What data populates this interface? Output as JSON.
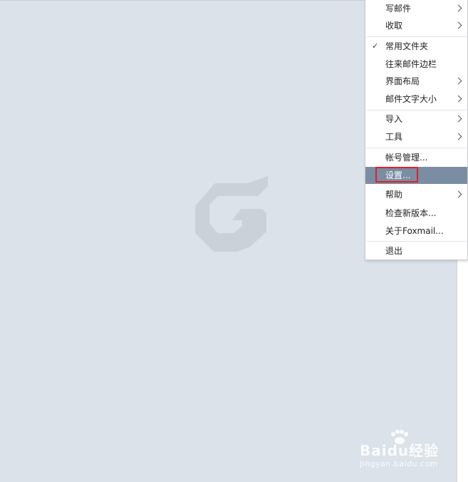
{
  "menu": {
    "items": [
      {
        "label": "写邮件",
        "submenu": true
      },
      {
        "label": "收取",
        "submenu": true
      },
      {
        "label": "常用文件夹",
        "checked": true
      },
      {
        "label": "往来邮件边栏"
      },
      {
        "label": "界面布局",
        "submenu": true
      },
      {
        "label": "邮件文字大小",
        "submenu": true
      },
      {
        "label": "导入",
        "submenu": true
      },
      {
        "label": "工具",
        "submenu": true
      },
      {
        "label": "帐号管理..."
      },
      {
        "label": "设置...",
        "highlighted": true
      },
      {
        "label": "帮助",
        "submenu": true
      },
      {
        "label": "检查新版本..."
      },
      {
        "label": "关于Foxmail..."
      },
      {
        "label": "退出"
      }
    ],
    "check_glyph": "✓"
  },
  "watermark": {
    "main": "Baidu经验",
    "sub": "jingyan.baidu.com"
  },
  "colors": {
    "background": "#dce2e9",
    "highlight": "#7a8da3",
    "annotation": "#e0212b"
  }
}
